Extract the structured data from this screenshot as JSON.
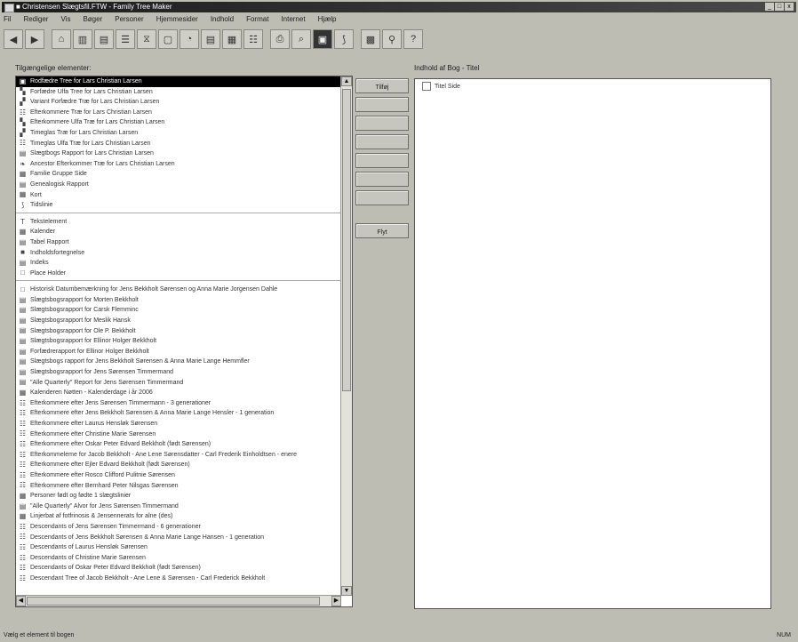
{
  "window": {
    "title": "■ Christensen Slægtsfil.FTW - Family Tree Maker",
    "controls": [
      "_",
      "□",
      "x"
    ]
  },
  "menu": [
    "Fil",
    "Rediger",
    "Vis",
    "Bøger",
    "Personer",
    "Hjemmesider",
    "Indhold",
    "Format",
    "Internet",
    "Hjælp"
  ],
  "toolbar_icons": [
    "left-arrow-icon",
    "right-arrow-icon",
    "family-icon",
    "pedigree-icon",
    "descendant-icon",
    "outline-icon",
    "hourglass-icon",
    "box-icon",
    "fan-icon",
    "report-icon",
    "scrapbook-icon",
    "genealogy-icon",
    "print-icon",
    "zoom-icon",
    "book-icon",
    "timeline-icon",
    "map-icon",
    "search-icon",
    "help-icon"
  ],
  "left_panel": {
    "label": "Tilgængelige elementer:",
    "groups": [
      [
        {
          "icon": "▣",
          "text": "Rodfædre Tree for Lars Christian Larsen",
          "selected": true
        },
        {
          "icon": "▚",
          "text": "Forfædre Ulfa Tree for Lars Christian Larsen"
        },
        {
          "icon": "▞",
          "text": "Variant Forfædre Træ for Lars Christian Larsen"
        },
        {
          "icon": "☷",
          "text": "Efterkommere Træ for Lars Christian Larsen"
        },
        {
          "icon": "▚",
          "text": "Efterkommere Ulfa Træ for Lars Christian Larsen"
        },
        {
          "icon": "▞",
          "text": "Timeglas Træ for Lars Christian Larsen"
        },
        {
          "icon": "☷",
          "text": "Timeglas Ulfa Træ for Lars Christian Larsen"
        },
        {
          "icon": "▤",
          "text": "Slægtbogs Rapport for Lars Christian Larsen"
        },
        {
          "icon": "❧",
          "text": "Ancestor Efterkommer Træ for Lars Christian Larsen"
        },
        {
          "icon": "▦",
          "text": "Familie Gruppe Side"
        },
        {
          "icon": "▤",
          "text": "Genealogisk Rapport"
        },
        {
          "icon": "▦",
          "text": "Kort"
        },
        {
          "icon": "⟆",
          "text": "Tidslinie"
        }
      ],
      [
        {
          "icon": "T",
          "text": "Tekstelement"
        },
        {
          "icon": "▦",
          "text": "Kalender"
        },
        {
          "icon": "▤",
          "text": "Tabel Rapport"
        },
        {
          "icon": "■",
          "text": "Indholdsfortegnelse"
        },
        {
          "icon": "▤",
          "text": "Indeks"
        },
        {
          "icon": "□",
          "text": "Place Holder"
        }
      ],
      [
        {
          "icon": "□",
          "text": "Historisk Datumbemærkning for Jens Bekkholt Sørensen og Anna Marie Jorgensen Dahle"
        },
        {
          "icon": "▤",
          "text": "Slægtsbogsrapport for Morten Bekkholt"
        },
        {
          "icon": "▤",
          "text": "Slægtsbogsrapport for Carsk Flemminc"
        },
        {
          "icon": "▤",
          "text": "Slægtsbogsrapport for Meslik Hansk"
        },
        {
          "icon": "▤",
          "text": "Slægtsbogsrapport for Ole P. Bekkholt"
        },
        {
          "icon": "▤",
          "text": "Slægtsbogsrapport for Ellinor Holger Bekkholt"
        },
        {
          "icon": "▤",
          "text": "Forfædrerapport for Ellinor Holger Bekkholt"
        },
        {
          "icon": "▤",
          "text": "Slægtsbogs rapport for Jens Bekkholt Sørensen & Anna Marie Lange Hemmfler"
        },
        {
          "icon": "▤",
          "text": "Slægtsbogsrapport for Jens Sørensen Timmermand"
        },
        {
          "icon": "▤",
          "text": "\"Alle Quarterly\" Report for Jens Sørensen Timmermand"
        },
        {
          "icon": "▦",
          "text": "Kalenderen Nøtten - Kalenderdage i år 2006"
        },
        {
          "icon": "☷",
          "text": "Efterkommere efter Jens Sørensen Timmermann - 3 generationer"
        },
        {
          "icon": "☷",
          "text": "Efterkommere efter Jens Bekkholt Sørensen & Anna Marie Lange Hensler - 1 generation"
        },
        {
          "icon": "☷",
          "text": "Efterkommere efter Laurus Hensløk Sørensen"
        },
        {
          "icon": "☷",
          "text": "Efterkommere efter Christine Marie Sørensen"
        },
        {
          "icon": "☷",
          "text": "Efterkommere efter Oskar Peter Edvard Bekkholt (født Sørensen)"
        },
        {
          "icon": "☷",
          "text": "Efterkommeleme for Jacob Bekkholt - Ane Lene Sørensdatter - Carl Frederik Einholdtsen - enere"
        },
        {
          "icon": "☷",
          "text": "Efterkommere efter Ejler Edvard Bekkholt (født Sørensen)"
        },
        {
          "icon": "☷",
          "text": "Efterkommere efter Rosco Clifford Pulitnie Sørensen"
        },
        {
          "icon": "☷",
          "text": "Efterkommere efter Bernhard Peter Nilsgas Sørensen"
        },
        {
          "icon": "▦",
          "text": "Personer født og fødte 1 slægtslinier"
        },
        {
          "icon": "▤",
          "text": "\"Alle Quarterly\" Alvor for Jens Sørensen Timmermand"
        },
        {
          "icon": "▦",
          "text": "Linjerbat af fotfrinosis & Jensennerats for alne (des)"
        },
        {
          "icon": "☷",
          "text": "Descendants of Jens Sørensen Timmermand - 6 generationer"
        },
        {
          "icon": "☷",
          "text": "Descendants of Jens Bekkholt Sørensen & Anna Marie Lange Hansen - 1 generation"
        },
        {
          "icon": "☷",
          "text": "Descendants of Laurus Hensløk Sørensen"
        },
        {
          "icon": "☷",
          "text": "Descendants of Christine Marie Sørensen"
        },
        {
          "icon": "☷",
          "text": "Descendants of Oskar Peter Edvard Bekkholt (født Sørensen)"
        },
        {
          "icon": "☷",
          "text": "Descendant Tree of Jacob Bekkholt - Ane Lene & Sørensen - Carl Frederick Bekkholt"
        }
      ]
    ]
  },
  "buttons": [
    "Tilføj",
    "",
    "",
    "",
    "",
    "",
    "",
    "Flyt"
  ],
  "right_panel": {
    "label": "Indhold af Bog - Titel",
    "items": [
      "Titel Side"
    ]
  },
  "status": {
    "left": "Vælg et element til bogen",
    "right": "NUM"
  }
}
